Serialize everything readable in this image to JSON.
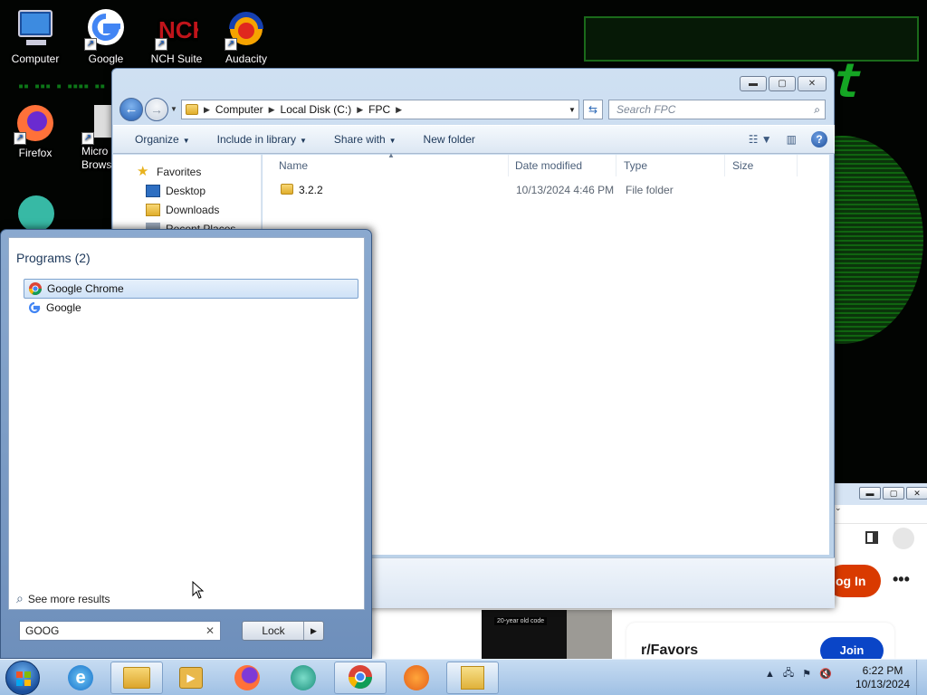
{
  "desktop": {
    "icons": [
      {
        "label": "Computer"
      },
      {
        "label": "Google"
      },
      {
        "label": "NCH Suite"
      },
      {
        "label": "Audacity"
      },
      {
        "label": "Firefox"
      },
      {
        "label": "Micro Brows"
      }
    ]
  },
  "explorer": {
    "breadcrumb": [
      "Computer",
      "Local Disk (C:)",
      "FPC"
    ],
    "search_placeholder": "Search FPC",
    "toolbar": {
      "organize": "Organize",
      "include_in_library": "Include in library",
      "share_with": "Share with",
      "new_folder": "New folder"
    },
    "nav": {
      "favorites": "Favorites",
      "desktop": "Desktop",
      "downloads": "Downloads",
      "recent_places": "Recent Places"
    },
    "columns": {
      "name": "Name",
      "date_modified": "Date modified",
      "type": "Type",
      "size": "Size"
    },
    "rows": [
      {
        "name": "3.2.2",
        "date_modified": "10/13/2024 4:46 PM",
        "type": "File folder",
        "size": ""
      }
    ]
  },
  "browser": {
    "login_label": "og In",
    "more_label": "•••",
    "video_label": "20-year old code",
    "subreddit": "r/Favors",
    "join_label": "Join"
  },
  "start_menu": {
    "programs_header": "Programs (2)",
    "programs": [
      {
        "label": "Google Chrome",
        "selected": true
      },
      {
        "label": "Google",
        "selected": false
      }
    ],
    "see_more": "See more results",
    "search_value": "GOOG",
    "lock_label": "Lock"
  },
  "taskbar": {
    "time": "6:22 PM",
    "date": "10/13/2024"
  },
  "colors": {
    "accent": "#245db0",
    "matrix_green": "#19c32a",
    "reddit_orange": "#d93a00",
    "reddit_blue": "#0a45c7"
  }
}
